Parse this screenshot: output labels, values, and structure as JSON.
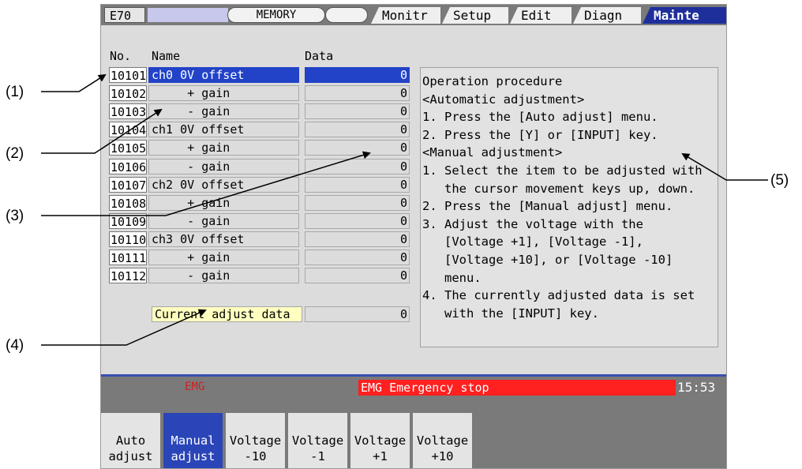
{
  "topbar": {
    "system": "E70",
    "mode": "MEMORY",
    "tabs": [
      "Monitr",
      "Setup",
      "Edit",
      "Diagn",
      "Mainte"
    ],
    "active_tab": "Mainte"
  },
  "table": {
    "headers": {
      "no": "No.",
      "name": "Name",
      "data": "Data"
    },
    "rows": [
      {
        "no": "10101",
        "name": "ch0 0V offset",
        "data": "0"
      },
      {
        "no": "10102",
        "name": "     + gain",
        "data": "0"
      },
      {
        "no": "10103",
        "name": "     - gain",
        "data": "0"
      },
      {
        "no": "10104",
        "name": "ch1 0V offset",
        "data": "0"
      },
      {
        "no": "10105",
        "name": "     + gain",
        "data": "0"
      },
      {
        "no": "10106",
        "name": "     - gain",
        "data": "0"
      },
      {
        "no": "10107",
        "name": "ch2 0V offset",
        "data": "0"
      },
      {
        "no": "10108",
        "name": "     + gain",
        "data": "0"
      },
      {
        "no": "10109",
        "name": "     - gain",
        "data": "0"
      },
      {
        "no": "10110",
        "name": "ch3 0V offset",
        "data": "0"
      },
      {
        "no": "10111",
        "name": "     + gain",
        "data": "0"
      },
      {
        "no": "10112",
        "name": "     - gain",
        "data": "0"
      }
    ],
    "selected_row": 0
  },
  "current_adjust": {
    "label": "Current adjust data",
    "value": "0"
  },
  "procedure": [
    "Operation procedure",
    "",
    "<Automatic adjustment>",
    "1. Press the [Auto adjust] menu.",
    "2. Press the [Y] or [INPUT] key.",
    "",
    "<Manual adjustment>",
    "1. Select the item to be adjusted with",
    "   the cursor movement keys up, down.",
    "2. Press the [Manual adjust] menu.",
    "3. Adjust the voltage with the",
    "   [Voltage +1], [Voltage -1],",
    "   [Voltage +10], or [Voltage -10]",
    "   menu.",
    "4. The currently adjusted data is set",
    "   with the [INPUT] key."
  ],
  "status": {
    "emg_indicator": "EMG",
    "message": "EMG  Emergency stop",
    "time": "15:53"
  },
  "function_keys": [
    {
      "line1": "Auto",
      "line2": "adjust"
    },
    {
      "line1": "Manual",
      "line2": "adjust"
    },
    {
      "line1": "Voltage",
      "line2": "-10"
    },
    {
      "line1": "Voltage",
      "line2": "-1"
    },
    {
      "line1": "Voltage",
      "line2": "+1"
    },
    {
      "line1": "Voltage",
      "line2": "+10"
    }
  ],
  "active_function_key": 1,
  "callouts": [
    "(1)",
    "(2)",
    "(3)",
    "(4)",
    "(5)"
  ]
}
